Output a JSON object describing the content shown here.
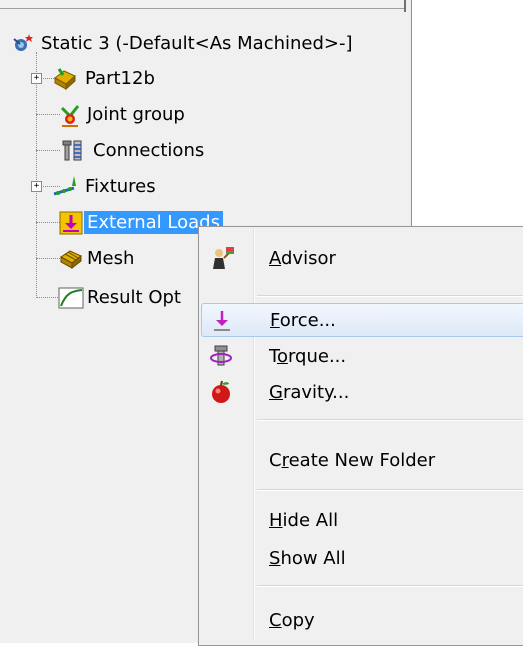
{
  "tree": {
    "root_label": "Static 3 (-Default<As Machined>-]",
    "items": [
      {
        "label": "Part12b",
        "icon": "part-icon",
        "expandable": true
      },
      {
        "label": "Joint group",
        "icon": "joint-group-icon",
        "expandable": false
      },
      {
        "label": "Connections",
        "icon": "connections-icon",
        "expandable": false
      },
      {
        "label": "Fixtures",
        "icon": "fixtures-icon",
        "expandable": true
      },
      {
        "label": "External Loads",
        "icon": "external-loads-icon",
        "expandable": false,
        "selected": true
      },
      {
        "label": "Mesh",
        "icon": "mesh-icon",
        "expandable": false
      },
      {
        "label": "Result Opt",
        "icon": "result-options-icon",
        "expandable": false
      }
    ]
  },
  "menu": {
    "items": [
      {
        "id": "advisor",
        "pre": "",
        "mnemonic": "A",
        "post": "dvisor",
        "icon": "advisor-icon"
      },
      {
        "id": "force",
        "pre": "",
        "mnemonic": "F",
        "post": "orce...",
        "icon": "force-arrow-icon",
        "hovered": true
      },
      {
        "id": "torque",
        "pre": "T",
        "mnemonic": "o",
        "post": "rque...",
        "icon": "torque-icon"
      },
      {
        "id": "gravity",
        "pre": "",
        "mnemonic": "G",
        "post": "ravity...",
        "icon": "gravity-apple-icon"
      },
      {
        "id": "create-folder",
        "pre": "C",
        "mnemonic": "r",
        "post": "eate New Folder",
        "icon": ""
      },
      {
        "id": "hide-all",
        "pre": "",
        "mnemonic": "H",
        "post": "ide All",
        "icon": ""
      },
      {
        "id": "show-all",
        "pre": "",
        "mnemonic": "S",
        "post": "how All",
        "icon": ""
      },
      {
        "id": "copy",
        "pre": "",
        "mnemonic": "C",
        "post": "opy",
        "icon": ""
      }
    ]
  },
  "colors": {
    "selection": "#3399ff",
    "menu_hover_border": "#a8c8ee",
    "force_arrow": "#c020c0"
  }
}
